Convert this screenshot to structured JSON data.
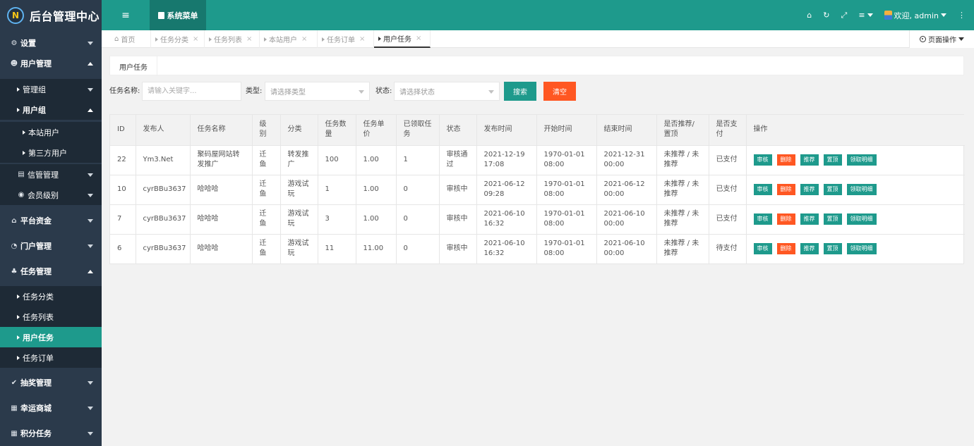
{
  "app": {
    "logo_letter": "N",
    "title": "后台管理中心",
    "menu_toggle": "≡",
    "system_menu": "系统菜单",
    "welcome": "欢迎, admin"
  },
  "sidebar": {
    "settings": "设置",
    "user_mgmt": "用户管理",
    "admin_group": "管理组",
    "user_group": "用户组",
    "local_users": "本站用户",
    "third_party_users": "第三方用户",
    "message_mgmt": "信管管理",
    "member_level": "会员级别",
    "platform_funds": "平台资金",
    "portal_mgmt": "门户管理",
    "task_mgmt": "任务管理",
    "task_category": "任务分类",
    "task_list": "任务列表",
    "user_tasks": "用户任务",
    "task_orders": "任务订单",
    "lottery_mgmt": "抽奖管理",
    "lucky_mall": "幸运商城",
    "points_tasks": "积分任务"
  },
  "tabs": {
    "home": "首页",
    "t1": "任务分类",
    "t2": "任务列表",
    "t3": "本站用户",
    "t4": "任务订单",
    "t5": "用户任务",
    "close": "×",
    "page_ops": "页面操作"
  },
  "content": {
    "subtab": "用户任务",
    "filter": {
      "name_label": "任务名称:",
      "name_placeholder": "请输入关键字...",
      "type_label": "类型:",
      "type_placeholder": "请选择类型",
      "status_label": "状态:",
      "status_placeholder": "请选择状态",
      "search": "搜索",
      "clear": "清空"
    },
    "table": {
      "headers": [
        "ID",
        "发布人",
        "任务名称",
        "级别",
        "分类",
        "任务数量",
        "任务单价",
        "已领取任务",
        "状态",
        "发布时间",
        "开始时间",
        "结束时间",
        "是否推荐/置顶",
        "是否支付",
        "操作"
      ],
      "rows": [
        [
          "22",
          "Ym3.Net",
          "聚码屋网站转发推广",
          "迁鱼",
          "转发推广",
          "100",
          "1.00",
          "1",
          "审核通过",
          "2021-12-19 17:08",
          "1970-01-01 08:00",
          "2021-12-31 00:00",
          "未推荐 / 未推荐",
          "已支付"
        ],
        [
          "10",
          "cyrBBu3637",
          "哈哈哈",
          "迁鱼",
          "游戏试玩",
          "1",
          "1.00",
          "0",
          "审核中",
          "2021-06-12 09:28",
          "1970-01-01 08:00",
          "2021-06-12 00:00",
          "未推荐 / 未推荐",
          "已支付"
        ],
        [
          "7",
          "cyrBBu3637",
          "哈哈哈",
          "迁鱼",
          "游戏试玩",
          "3",
          "1.00",
          "0",
          "审核中",
          "2021-06-10 16:32",
          "1970-01-01 08:00",
          "2021-06-10 00:00",
          "未推荐 / 未推荐",
          "已支付"
        ],
        [
          "6",
          "cyrBBu3637",
          "哈哈哈",
          "迁鱼",
          "游戏试玩",
          "11",
          "11.00",
          "0",
          "审核中",
          "2021-06-10 16:32",
          "1970-01-01 08:00",
          "2021-06-10 00:00",
          "未推荐 / 未推荐",
          "待支付"
        ]
      ],
      "actions": [
        "审核",
        "删除",
        "推荐",
        "置顶",
        "领取明细"
      ]
    }
  },
  "colors": {
    "primary": "#1e9a8c",
    "sidebar": "#2b3a4b",
    "danger": "#ff5722"
  }
}
